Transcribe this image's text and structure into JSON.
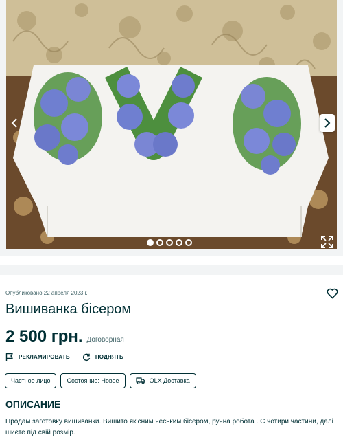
{
  "gallery": {
    "image_alt": "",
    "slide_count": 5,
    "active_slide": 1
  },
  "listing": {
    "published": "Опубликовано 22 апреля 2023 г.",
    "title": "Вишиванка бісером",
    "price": "2 500 грн.",
    "negotiable": "Договорная"
  },
  "actions": {
    "promote_label": "РЕКЛАМИРОВАТЬ",
    "raise_label": "ПОДНЯТЬ"
  },
  "tags": {
    "seller_type": "Частное лицо",
    "condition": "Состояние: Новое",
    "delivery": "OLX Доставка"
  },
  "description": {
    "heading": "ОПИСАНИЕ",
    "text": "Продам заготовку вишиванки. Вишито якісним чеським бісером, ручна робота . Є чотири частини, далі шиєте під свій розмір."
  },
  "colors": {
    "text_primary": "#002f34",
    "text_secondary": "#406367",
    "background_band": "#f2f4f5"
  }
}
